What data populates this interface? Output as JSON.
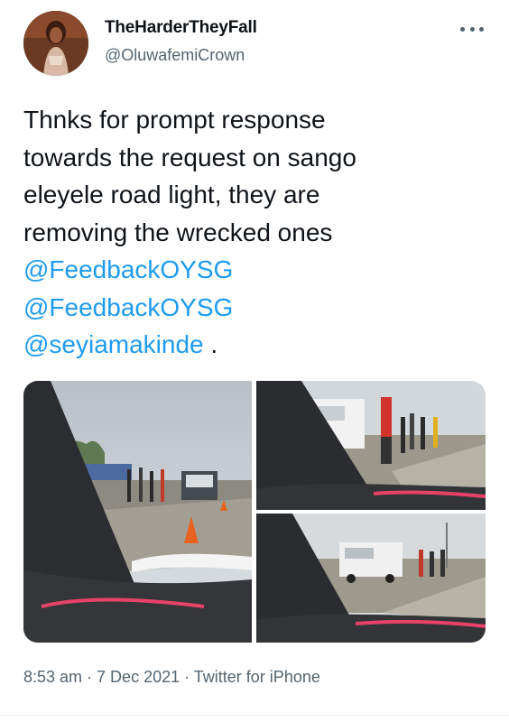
{
  "author": {
    "name": "TheHarderTheyFall",
    "handle": "@OluwafemiCrown"
  },
  "tweet": {
    "lines": [
      "Thnks for prompt response",
      "towards the request on sango",
      "eleyele road light, they are",
      "removing the wrecked ones"
    ],
    "mentions": [
      "@FeedbackOYSG",
      "@FeedbackOYSG",
      "@seyiamakinde"
    ],
    "trailing": " ."
  },
  "meta": {
    "time": "8:53 am",
    "date": "7 Dec 2021",
    "source": "Twitter for iPhone",
    "separator": " · "
  },
  "colors": {
    "mention": "#1d9bf0",
    "text": "#0f1419",
    "secondary": "#536471"
  },
  "icons": {
    "more": "more-horizontal-icon"
  }
}
